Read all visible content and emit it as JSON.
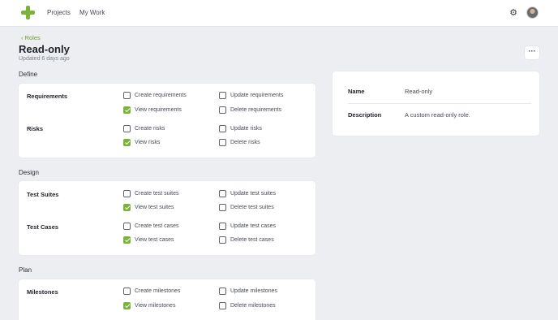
{
  "nav": {
    "projects": "Projects",
    "my_work": "My Work"
  },
  "icons": {
    "logo": "plus-logo-icon",
    "settings": "gear-icon",
    "avatar": "user-avatar",
    "back": "chevron-left-icon",
    "more": "ellipsis-icon"
  },
  "colors": {
    "accent": "#7ab33a",
    "background": "#eceef1",
    "card": "#ffffff"
  },
  "header": {
    "back_label": "Roles",
    "title": "Read-only",
    "updated": "Updated 6 days ago",
    "more_label": "···"
  },
  "sections": [
    {
      "title": "Define",
      "groups": [
        {
          "label": "Requirements",
          "permissions": [
            {
              "label": "Create requirements",
              "checked": false
            },
            {
              "label": "Update requirements",
              "checked": false
            },
            {
              "label": "View requirements",
              "checked": true
            },
            {
              "label": "Delete requirements",
              "checked": false
            }
          ]
        },
        {
          "label": "Risks",
          "permissions": [
            {
              "label": "Create risks",
              "checked": false
            },
            {
              "label": "Update risks",
              "checked": false
            },
            {
              "label": "View risks",
              "checked": true
            },
            {
              "label": "Delete risks",
              "checked": false
            }
          ]
        }
      ]
    },
    {
      "title": "Design",
      "groups": [
        {
          "label": "Test Suites",
          "permissions": [
            {
              "label": "Create test suites",
              "checked": false
            },
            {
              "label": "Update test suites",
              "checked": false
            },
            {
              "label": "View test suites",
              "checked": true
            },
            {
              "label": "Delete test suites",
              "checked": false
            }
          ]
        },
        {
          "label": "Test Cases",
          "permissions": [
            {
              "label": "Create test cases",
              "checked": false
            },
            {
              "label": "Update test cases",
              "checked": false
            },
            {
              "label": "View test cases",
              "checked": true
            },
            {
              "label": "Delete test cases",
              "checked": false
            }
          ]
        }
      ]
    },
    {
      "title": "Plan",
      "groups": [
        {
          "label": "Milestones",
          "permissions": [
            {
              "label": "Create milestones",
              "checked": false
            },
            {
              "label": "Update milestones",
              "checked": false
            },
            {
              "label": "View milestones",
              "checked": true
            },
            {
              "label": "Delete milestones",
              "checked": false
            }
          ]
        }
      ]
    }
  ],
  "details": {
    "name_label": "Name",
    "name_value": "Read-only",
    "description_label": "Description",
    "description_value": "A custom read-only role."
  }
}
